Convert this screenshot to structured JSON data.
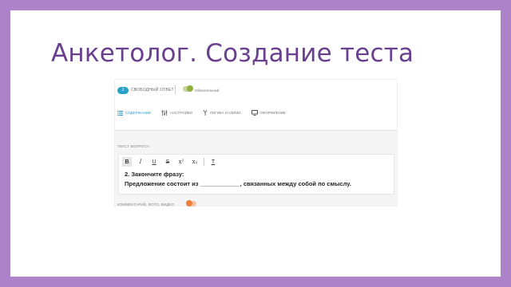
{
  "slide": {
    "title": "Анкетолог. Создание теста"
  },
  "header": {
    "question_number": "2",
    "question_type": "Свободный ответ",
    "required_label": "Обязательный",
    "required_on": true
  },
  "tabs": [
    {
      "label": "Содержание",
      "icon": "list-icon",
      "active": true
    },
    {
      "label": "Настройки",
      "icon": "settings-icon",
      "active": false
    },
    {
      "label": "Логика и связи",
      "icon": "branch-icon",
      "active": false
    },
    {
      "label": "Оформление",
      "icon": "monitor-icon",
      "active": false
    }
  ],
  "editor": {
    "label": "Текст вопроса",
    "toolbar": [
      "B",
      "I",
      "U",
      "S",
      "x²",
      "x₂",
      "T"
    ],
    "line1": "2. Закончите фразу:",
    "line2": "Предложение состоит из ____________, связанных между собой по смыслу."
  },
  "attachments": {
    "label": "Комментарий, фото, видео",
    "enabled": false
  },
  "colors": {
    "frame": "#ac83c9",
    "title": "#6b3f8f",
    "accent": "#28a0c8",
    "toggle_on": "#8fb03a",
    "toggle_off": "#f07e3a"
  }
}
